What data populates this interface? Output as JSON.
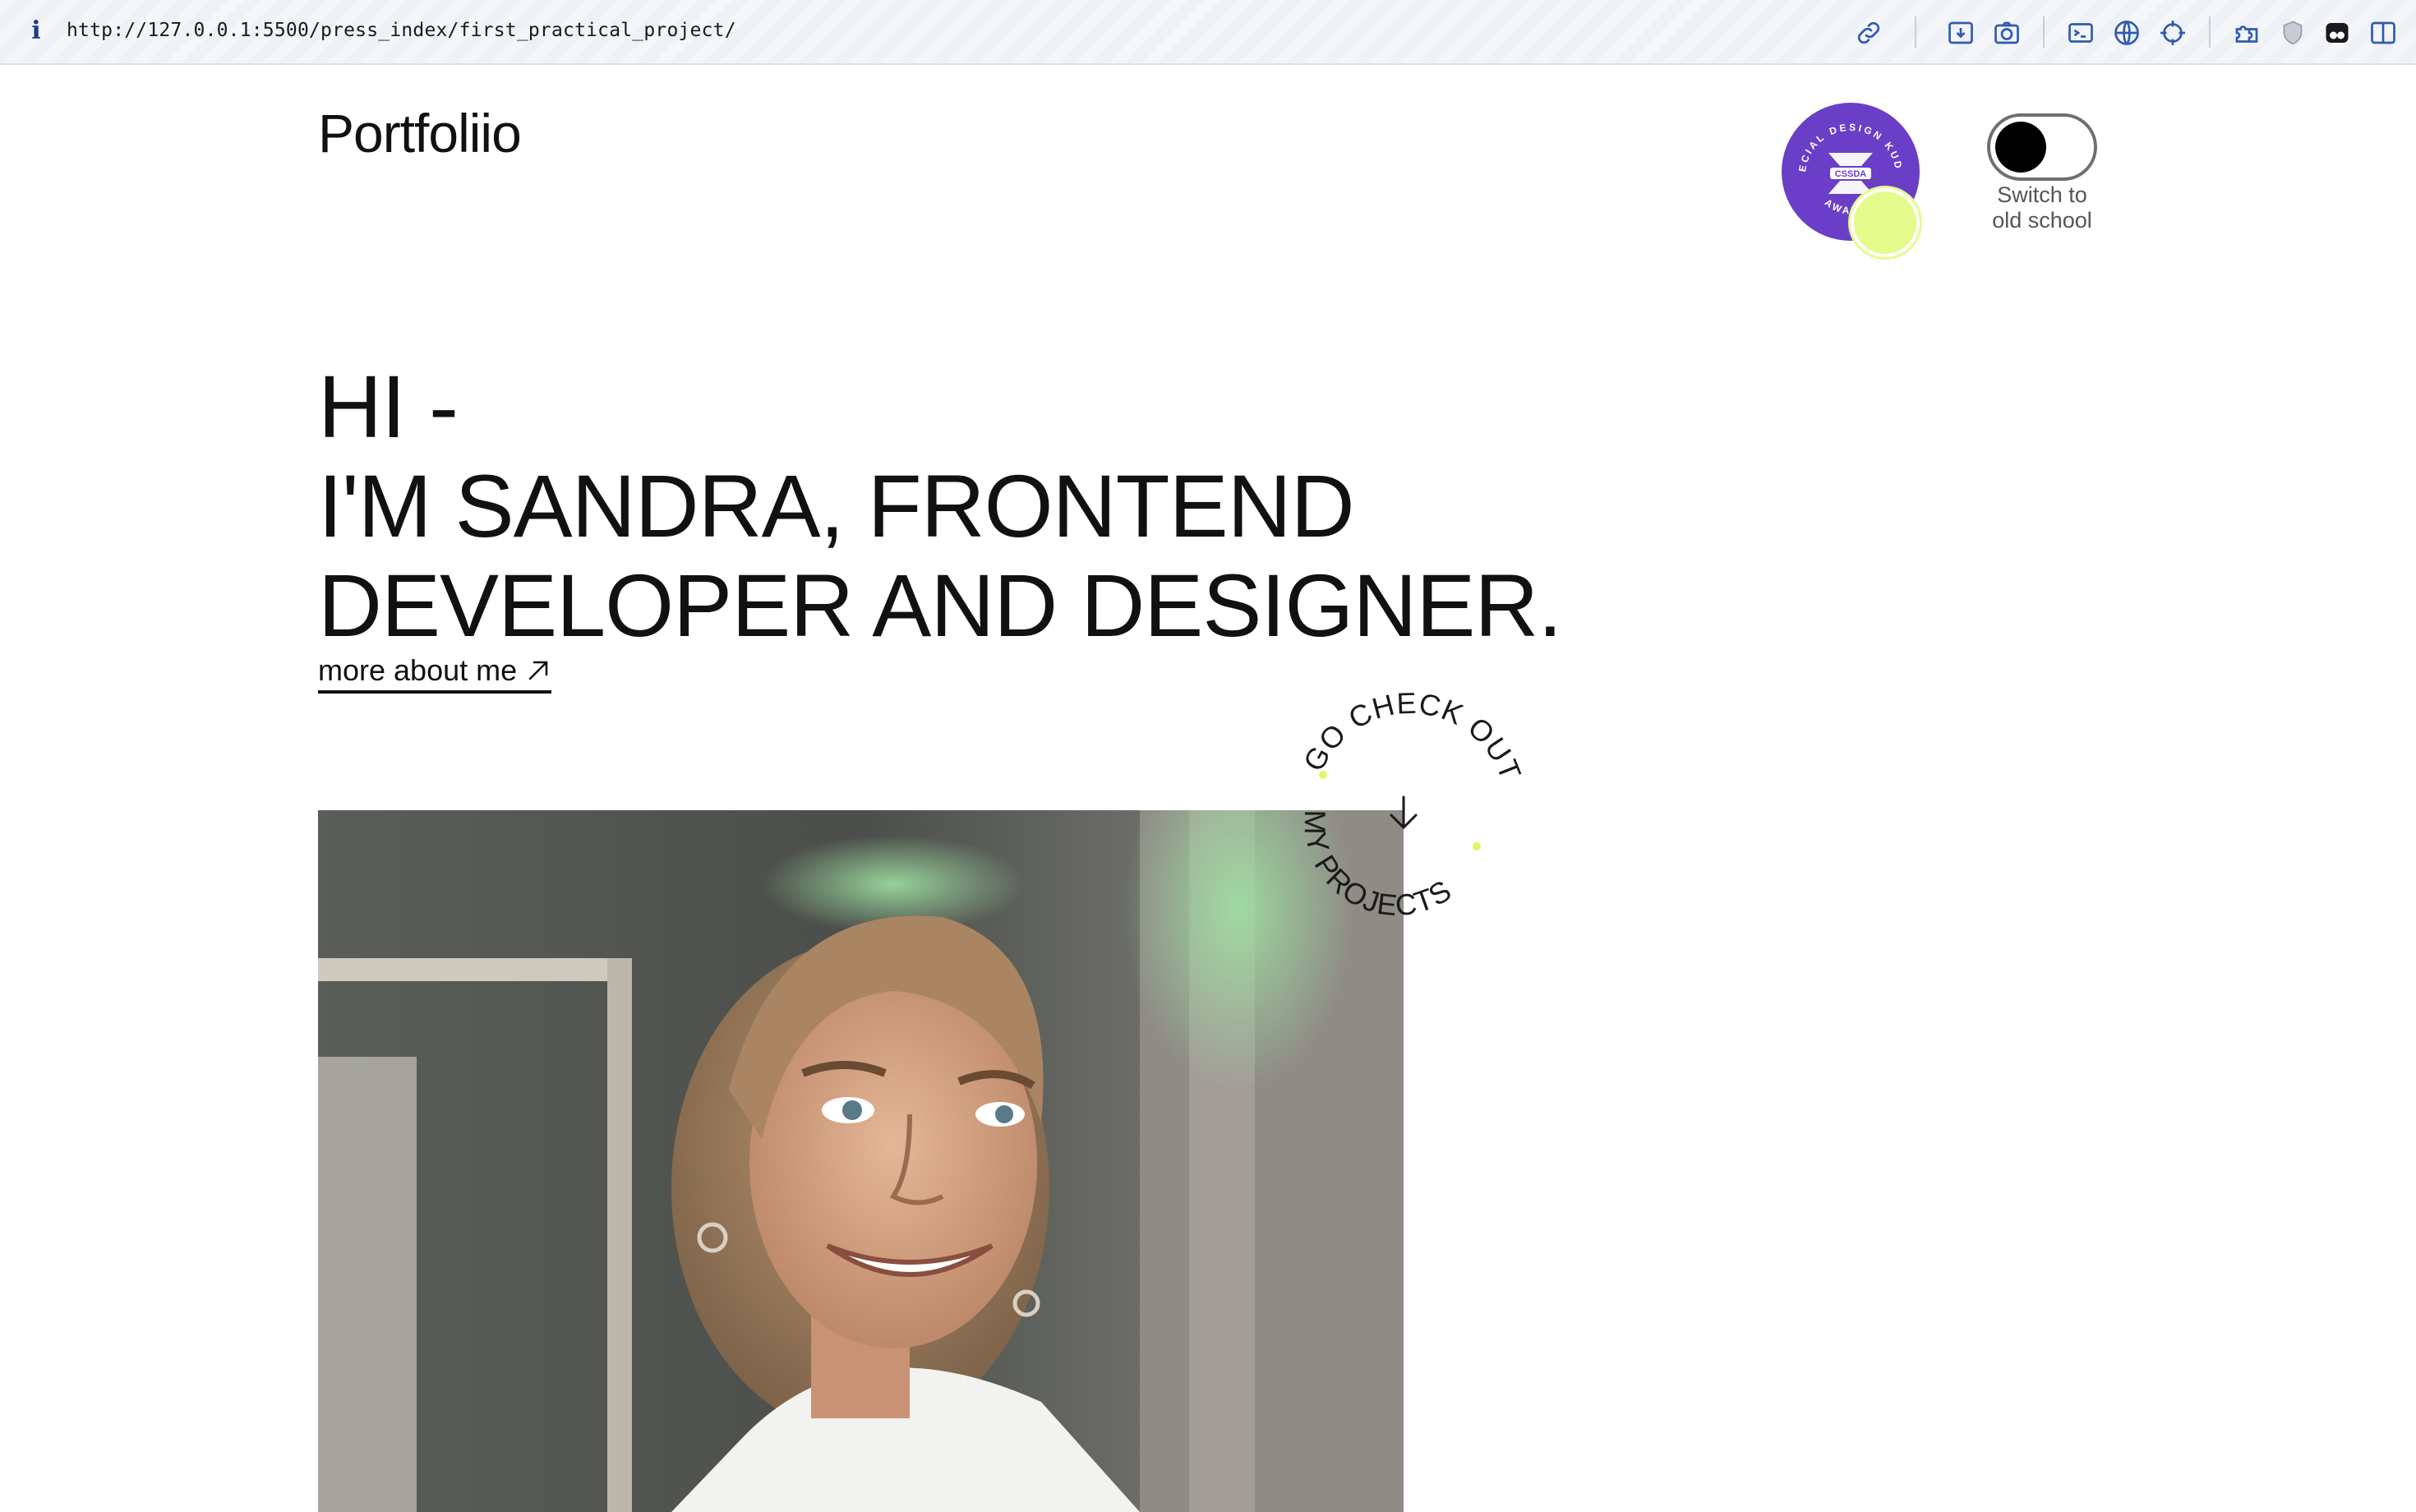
{
  "browser": {
    "url": "http://127.0.0.1:5500/press_index/first_practical_project/",
    "info_glyph": "i",
    "toolbar_icons": [
      "link-icon",
      "download-icon",
      "camera-icon",
      "terminal-icon",
      "globe-icon",
      "crosshair-icon",
      "extensions-icon",
      "shield-icon",
      "profile-icon",
      "sidebar-icon"
    ]
  },
  "header": {
    "logo": "Portfoliio",
    "badge": {
      "top_text": "SPECIAL DESIGN KUDOS",
      "center_text": "CSSDA",
      "bottom_text": "AWARDS",
      "color": "#6a3ec7"
    },
    "toggle": {
      "label_line1": "Switch to",
      "label_line2": "old school",
      "state": "off"
    }
  },
  "hero": {
    "line1": "HI -",
    "line2": "I'M SANDRA, FRONTEND",
    "line3": "DEVELOPER AND DESIGNER."
  },
  "about_link": {
    "label": "more about me"
  },
  "projects_cta": {
    "top_text": "GO CHECK OUT",
    "bottom_text": "MY PROJECTS",
    "accent_color": "#e2f56b"
  },
  "colors": {
    "cursor_highlight": "#e4fb8c",
    "text": "#111111",
    "badge": "#6a3ec7"
  }
}
